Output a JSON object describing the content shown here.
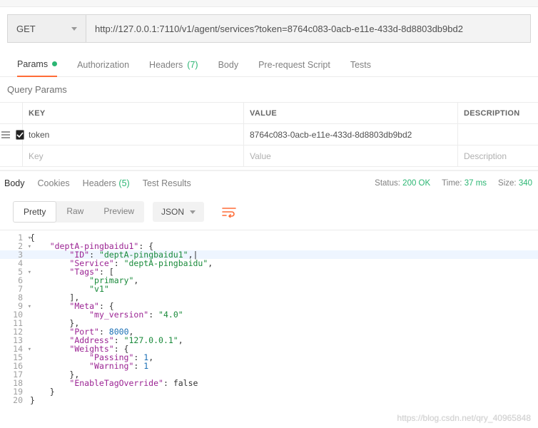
{
  "request": {
    "method": "GET",
    "url": "http://127.0.0.1:7110/v1/agent/services?token=8764c083-0acb-e11e-433d-8d8803db9bd2"
  },
  "tabs": {
    "params": "Params",
    "auth": "Authorization",
    "headers_label": "Headers",
    "headers_count": "(7)",
    "body": "Body",
    "prereq": "Pre-request Script",
    "tests": "Tests"
  },
  "query_params": {
    "title": "Query Params",
    "head_key": "KEY",
    "head_val": "VALUE",
    "head_desc": "DESCRIPTION",
    "rows": [
      {
        "key": "token",
        "value": "8764c083-0acb-e11e-433d-8d8803db9bd2",
        "desc": ""
      }
    ],
    "ph_key": "Key",
    "ph_val": "Value",
    "ph_desc": "Description"
  },
  "resp_tabs": {
    "body": "Body",
    "cookies": "Cookies",
    "headers_label": "Headers",
    "headers_count": "(5)",
    "tests": "Test Results"
  },
  "status": {
    "status_label": "Status:",
    "status_value": "200 OK",
    "time_label": "Time:",
    "time_value": "37 ms",
    "size_label": "Size:",
    "size_value": "340"
  },
  "view": {
    "pretty": "Pretty",
    "raw": "Raw",
    "preview": "Preview",
    "format": "JSON"
  },
  "watermark": "https://blog.csdn.net/qry_40965848",
  "json_body": {
    "deptA-pingbaidu1": {
      "ID": "deptA-pingbaidu1",
      "Service": "deptA-pingbaidu",
      "Tags": [
        "primary",
        "v1"
      ],
      "Meta": {
        "my_version": "4.0"
      },
      "Port": 8000,
      "Address": "127.0.0.1",
      "Weights": {
        "Passing": 1,
        "Warning": 1
      },
      "EnableTagOverride": false
    }
  },
  "code_lines": [
    {
      "n": 1,
      "fold": true,
      "ind": 0,
      "tok": [
        [
          "p",
          "{"
        ]
      ]
    },
    {
      "n": 2,
      "fold": true,
      "ind": 1,
      "tok": [
        [
          "k",
          "\"deptA-pingbaidu1\""
        ],
        [
          "p",
          ": {"
        ]
      ]
    },
    {
      "n": 3,
      "hl": true,
      "ind": 2,
      "tok": [
        [
          "k",
          "\"ID\""
        ],
        [
          "p",
          ": "
        ],
        [
          "s",
          "\"deptA-pingbaidu1\""
        ],
        [
          "p",
          ","
        ],
        [
          "p",
          "|"
        ]
      ]
    },
    {
      "n": 4,
      "ind": 2,
      "tok": [
        [
          "k",
          "\"Service\""
        ],
        [
          "p",
          ": "
        ],
        [
          "s",
          "\"deptA-pingbaidu\""
        ],
        [
          "p",
          ","
        ]
      ]
    },
    {
      "n": 5,
      "fold": true,
      "ind": 2,
      "tok": [
        [
          "k",
          "\"Tags\""
        ],
        [
          "p",
          ": ["
        ]
      ]
    },
    {
      "n": 6,
      "ind": 3,
      "tok": [
        [
          "s",
          "\"primary\""
        ],
        [
          "p",
          ","
        ]
      ]
    },
    {
      "n": 7,
      "ind": 3,
      "tok": [
        [
          "s",
          "\"v1\""
        ]
      ]
    },
    {
      "n": 8,
      "ind": 2,
      "tok": [
        [
          "p",
          "],"
        ]
      ]
    },
    {
      "n": 9,
      "fold": true,
      "ind": 2,
      "tok": [
        [
          "k",
          "\"Meta\""
        ],
        [
          "p",
          ": {"
        ]
      ]
    },
    {
      "n": 10,
      "ind": 3,
      "tok": [
        [
          "k",
          "\"my_version\""
        ],
        [
          "p",
          ": "
        ],
        [
          "s",
          "\"4.0\""
        ]
      ]
    },
    {
      "n": 11,
      "ind": 2,
      "tok": [
        [
          "p",
          "},"
        ]
      ]
    },
    {
      "n": 12,
      "ind": 2,
      "tok": [
        [
          "k",
          "\"Port\""
        ],
        [
          "p",
          ": "
        ],
        [
          "n",
          "8000"
        ],
        [
          "p",
          ","
        ]
      ]
    },
    {
      "n": 13,
      "ind": 2,
      "tok": [
        [
          "k",
          "\"Address\""
        ],
        [
          "p",
          ": "
        ],
        [
          "s",
          "\"127.0.0.1\""
        ],
        [
          "p",
          ","
        ]
      ]
    },
    {
      "n": 14,
      "fold": true,
      "ind": 2,
      "tok": [
        [
          "k",
          "\"Weights\""
        ],
        [
          "p",
          ": {"
        ]
      ]
    },
    {
      "n": 15,
      "ind": 3,
      "tok": [
        [
          "k",
          "\"Passing\""
        ],
        [
          "p",
          ": "
        ],
        [
          "n",
          "1"
        ],
        [
          "p",
          ","
        ]
      ]
    },
    {
      "n": 16,
      "ind": 3,
      "tok": [
        [
          "k",
          "\"Warning\""
        ],
        [
          "p",
          ": "
        ],
        [
          "n",
          "1"
        ]
      ]
    },
    {
      "n": 17,
      "ind": 2,
      "tok": [
        [
          "p",
          "},"
        ]
      ]
    },
    {
      "n": 18,
      "ind": 2,
      "tok": [
        [
          "k",
          "\"EnableTagOverride\""
        ],
        [
          "p",
          ": "
        ],
        [
          "b",
          "false"
        ]
      ]
    },
    {
      "n": 19,
      "ind": 1,
      "tok": [
        [
          "p",
          "}"
        ]
      ]
    },
    {
      "n": 20,
      "ind": 0,
      "tok": [
        [
          "p",
          "}"
        ]
      ]
    }
  ]
}
